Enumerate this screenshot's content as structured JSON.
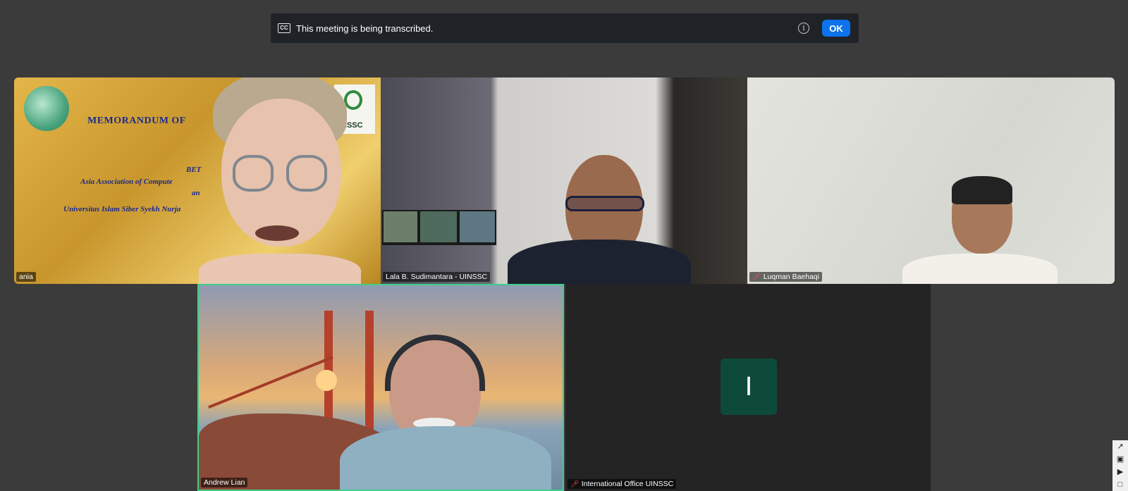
{
  "banner": {
    "cc_label": "CC",
    "text": "This meeting is being transcribed.",
    "info_glyph": "i",
    "ok_label": "OK",
    "accent": "#0e72ed"
  },
  "participants": [
    {
      "name": "ania",
      "muted": false
    },
    {
      "name": "Lala B. Sudimantara - UINSSC",
      "muted": false
    },
    {
      "name": "Luqman Baehaqi",
      "muted": true
    },
    {
      "name": "Andrew Lian",
      "muted": false,
      "active_speaker": true
    },
    {
      "name": "International Office UINSSC",
      "muted": true,
      "avatar_initial": "I"
    }
  ],
  "slide": {
    "title": "MEMORANDUM OF",
    "line1": "BET",
    "line2": "Asia Association of Compute",
    "line3": "an",
    "line4": "Universitas Islam Siber Syekh Nurja",
    "logo_text": "NSSC"
  },
  "icons": {
    "muted": "mic-muted-icon",
    "side_toolbar": [
      "share-icon",
      "camera-icon",
      "video-icon",
      "window-icon"
    ]
  },
  "colors": {
    "active_speaker_border": "#3bd08a",
    "muted_mic": "#ff4d4f",
    "avatar_bg": "#0e4a3a"
  }
}
